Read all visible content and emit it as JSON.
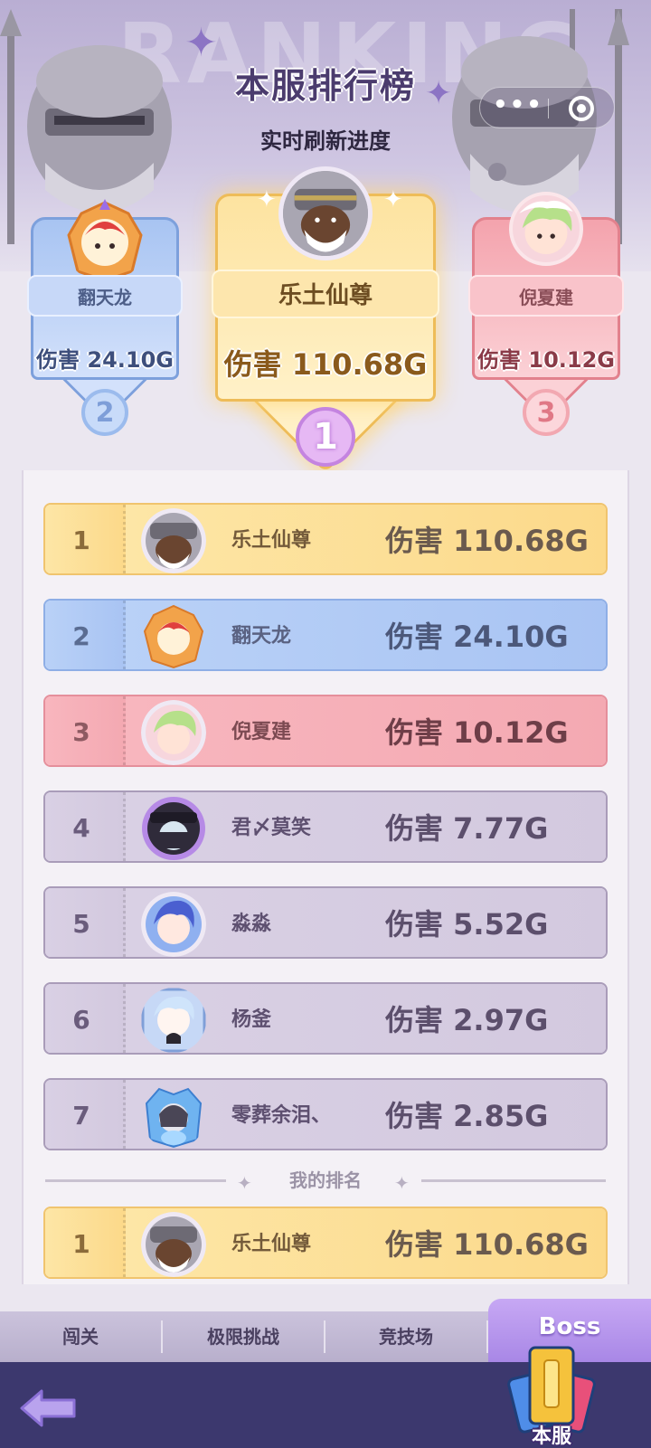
{
  "header": {
    "watermark": "RANKING",
    "title": "本服排行榜",
    "subtitle": "实时刷新进度"
  },
  "podium": [
    {
      "rank": "1",
      "name": "乐土仙尊",
      "damage": "伤害 110.68G"
    },
    {
      "rank": "2",
      "name": "翻天龙",
      "damage": "伤害 24.10G"
    },
    {
      "rank": "3",
      "name": "倪夏建",
      "damage": "伤害 10.12G"
    }
  ],
  "ranking": [
    {
      "rank": "1",
      "name": "乐土仙尊",
      "damage": "伤害 110.68G"
    },
    {
      "rank": "2",
      "name": "翻天龙",
      "damage": "伤害 24.10G"
    },
    {
      "rank": "3",
      "name": "倪夏建",
      "damage": "伤害 10.12G"
    },
    {
      "rank": "4",
      "name": "君〆莫笑",
      "damage": "伤害 7.77G"
    },
    {
      "rank": "5",
      "name": "淼淼",
      "damage": "伤害 5.52G"
    },
    {
      "rank": "6",
      "name": "杨釜",
      "damage": "伤害 2.97G"
    },
    {
      "rank": "7",
      "name": "零葬余泪、",
      "damage": "伤害 2.85G"
    }
  ],
  "my_rank": {
    "label": "我的排名",
    "rank": "1",
    "name": "乐土仙尊",
    "damage": "伤害 110.68G"
  },
  "tabs": {
    "t1": "闯关",
    "t2": "极限挑战",
    "t3": "竞技场",
    "t4": "Boss"
  },
  "bottom": {
    "server_label": "本服"
  },
  "colors": {
    "gold": "#fcd98a",
    "blue": "#a9c4f3",
    "pink": "#f4a9b2",
    "grey": "#d3c9df",
    "boss_tab": "#a887e6",
    "bottom_bar": "#3c386e"
  }
}
